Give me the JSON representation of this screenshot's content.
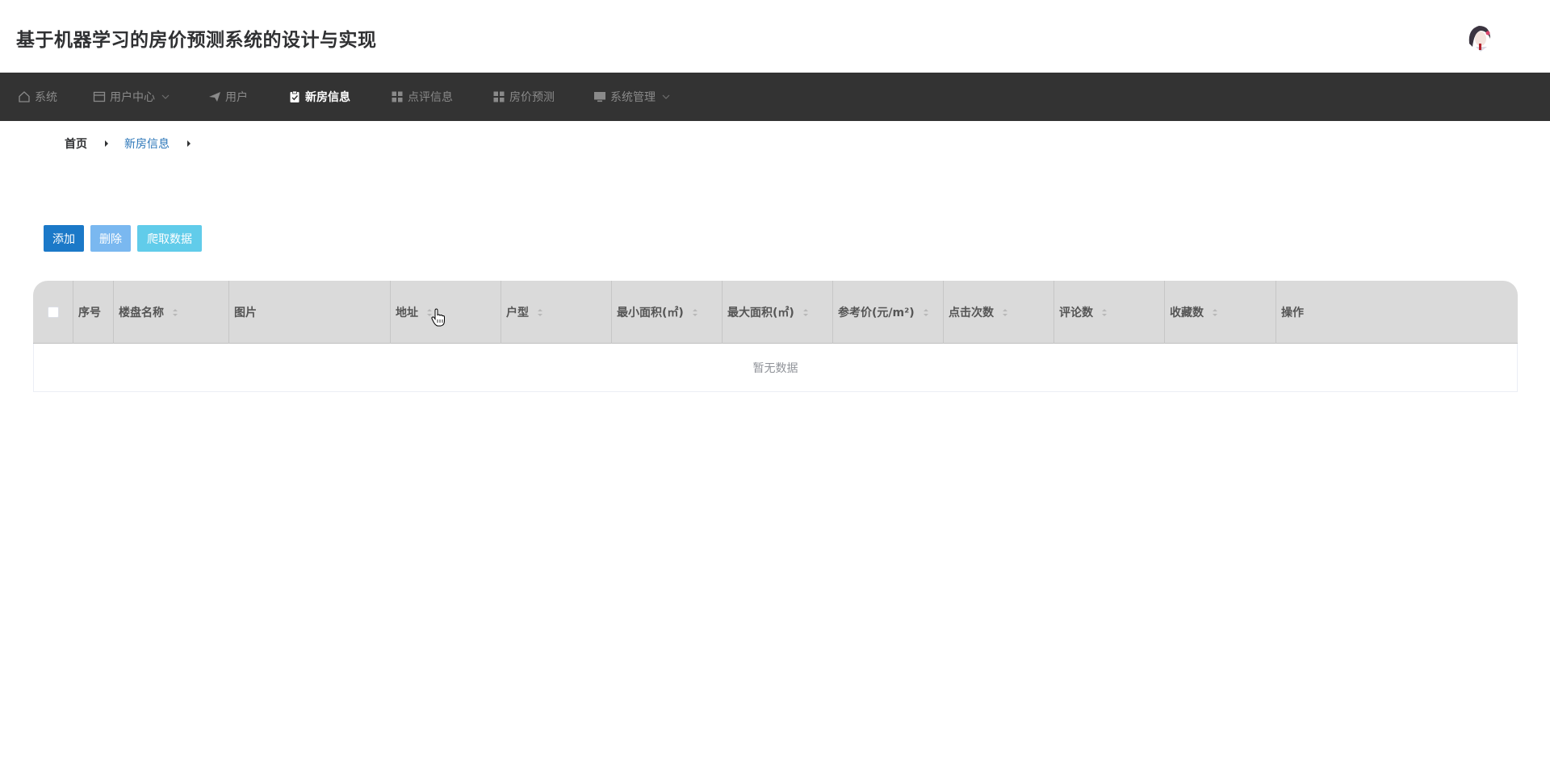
{
  "header": {
    "title": "基于机器学习的房价预测系统的设计与实现",
    "avatar": "user-avatar"
  },
  "nav": {
    "items": [
      {
        "label": "系统",
        "icon": "home-icon",
        "active": false,
        "dropdown": false
      },
      {
        "label": "用户中心",
        "icon": "card-icon",
        "active": false,
        "dropdown": true
      },
      {
        "label": "用户",
        "icon": "send-icon",
        "active": false,
        "dropdown": false
      },
      {
        "label": "新房信息",
        "icon": "clipboard-check-icon",
        "active": true,
        "dropdown": false
      },
      {
        "label": "点评信息",
        "icon": "grid-icon",
        "active": false,
        "dropdown": false
      },
      {
        "label": "房价预测",
        "icon": "grid-icon",
        "active": false,
        "dropdown": false
      },
      {
        "label": "系统管理",
        "icon": "monitor-icon",
        "active": false,
        "dropdown": true
      }
    ]
  },
  "breadcrumb": {
    "home": "首页",
    "current": "新房信息"
  },
  "toolbar": {
    "add_label": "添加",
    "delete_label": "删除",
    "crawl_label": "爬取数据"
  },
  "table": {
    "columns": [
      {
        "label": "",
        "sortable": false
      },
      {
        "label": "序号",
        "sortable": false
      },
      {
        "label": "楼盘名称",
        "sortable": true
      },
      {
        "label": "图片",
        "sortable": false
      },
      {
        "label": "地址",
        "sortable": true
      },
      {
        "label": "户型",
        "sortable": true
      },
      {
        "label": "最小面积(㎡)",
        "sortable": true
      },
      {
        "label": "最大面积(㎡)",
        "sortable": true
      },
      {
        "label": "参考价(元/m²)",
        "sortable": true
      },
      {
        "label": "点击次数",
        "sortable": true
      },
      {
        "label": "评论数",
        "sortable": true
      },
      {
        "label": "收藏数",
        "sortable": true
      },
      {
        "label": "操作",
        "sortable": false
      }
    ],
    "empty_text": "暂无数据"
  },
  "colors": {
    "navbar_bg": "#333333",
    "primary": "#1b79c8",
    "danger_light": "#7ab8f0",
    "info": "#61ccea",
    "header_bg": "#dadada"
  }
}
